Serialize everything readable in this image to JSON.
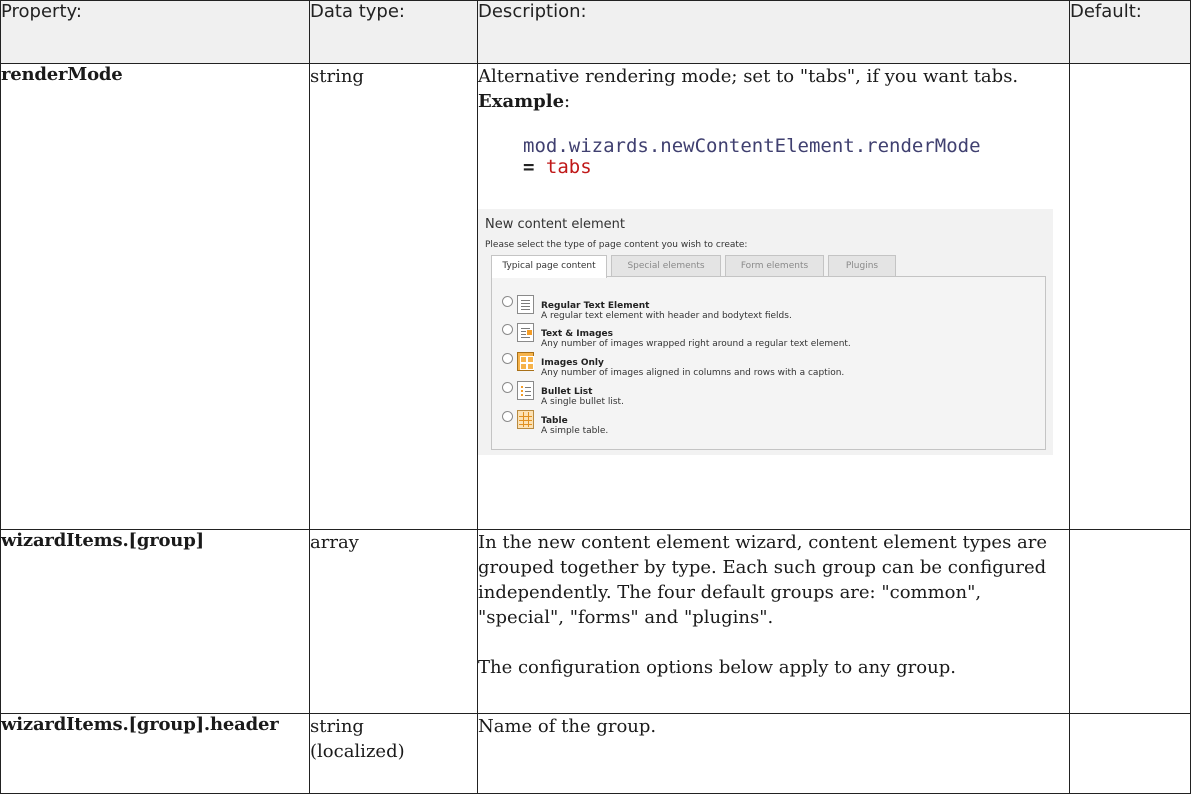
{
  "columns": {
    "property": "Property:",
    "data_type": "Data type:",
    "description": "Description:",
    "default": "Default:"
  },
  "rows": [
    {
      "property": "renderMode",
      "data_type": "string",
      "description": "Alternative rendering mode; set to \"tabs\", if you want tabs.",
      "example_label": "Example",
      "example_colon": ":",
      "code_path": "mod.wizards.newContentElement.renderMode",
      "code_op": "=",
      "code_value": "tabs",
      "default": ""
    },
    {
      "property": "wizardItems.[group]",
      "data_type": "array",
      "description": "In the new content element wizard, content element types are grouped together by type. Each such group can be configured independently. The four default groups are: \"common\", \"special\", \"forms\" and \"plugins\".",
      "description_2": "The configuration options below apply to any group.",
      "default": ""
    },
    {
      "property": "wizardItems.[group].header",
      "data_type": "string (localized)",
      "description": "Name of the group.",
      "default": ""
    }
  ],
  "screenshot": {
    "title": "New content element",
    "subtitle": "Please select the type of page content you wish to create:",
    "tabs": [
      "Typical page content",
      "Special elements",
      "Form elements",
      "Plugins"
    ],
    "items": [
      {
        "title": "Regular Text Element",
        "desc": "A regular text element with header and bodytext fields.",
        "icon": "text-icon"
      },
      {
        "title": "Text & Images",
        "desc": "Any number of images wrapped right around a regular text element.",
        "icon": "text-image-icon"
      },
      {
        "title": "Images Only",
        "desc": "Any number of images aligned in columns and rows with a caption.",
        "icon": "images-icon"
      },
      {
        "title": "Bullet List",
        "desc": "A single bullet list.",
        "icon": "bullet-list-icon"
      },
      {
        "title": "Table",
        "desc": "A simple table.",
        "icon": "table-icon"
      }
    ]
  }
}
